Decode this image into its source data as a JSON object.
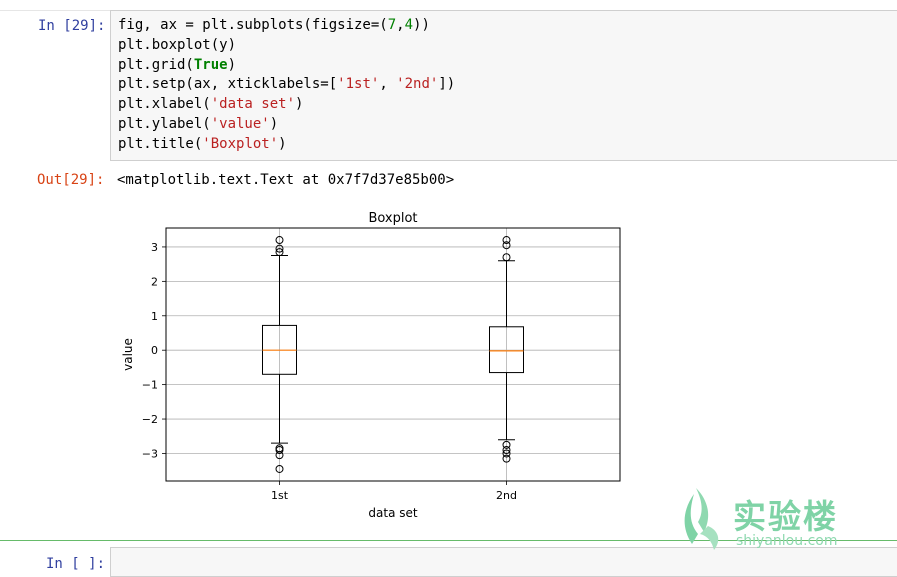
{
  "cells": {
    "code_prompt": "In [29]:",
    "code_lines": [
      [
        {
          "t": "fig, ax = plt.subplots(figsize=(",
          "c": ""
        },
        {
          "t": "7",
          "c": "num"
        },
        {
          "t": ",",
          "c": ""
        },
        {
          "t": "4",
          "c": "num"
        },
        {
          "t": "))",
          "c": ""
        }
      ],
      [
        {
          "t": "plt.boxplot(y)",
          "c": ""
        }
      ],
      [
        {
          "t": "plt.grid(",
          "c": ""
        },
        {
          "t": "True",
          "c": "kw"
        },
        {
          "t": ")",
          "c": ""
        }
      ],
      [
        {
          "t": "plt.setp(ax, xticklabels=[",
          "c": ""
        },
        {
          "t": "'1st'",
          "c": "str"
        },
        {
          "t": ", ",
          "c": ""
        },
        {
          "t": "'2nd'",
          "c": "str"
        },
        {
          "t": "])",
          "c": ""
        }
      ],
      [
        {
          "t": "plt.xlabel(",
          "c": ""
        },
        {
          "t": "'data set'",
          "c": "str"
        },
        {
          "t": ")",
          "c": ""
        }
      ],
      [
        {
          "t": "plt.ylabel(",
          "c": ""
        },
        {
          "t": "'value'",
          "c": "str"
        },
        {
          "t": ")",
          "c": ""
        }
      ],
      [
        {
          "t": "plt.title(",
          "c": ""
        },
        {
          "t": "'Boxplot'",
          "c": "str"
        },
        {
          "t": ")",
          "c": ""
        }
      ]
    ],
    "out_prompt": "Out[29]:",
    "out_text": "<matplotlib.text.Text at 0x7f7d37e85b00>",
    "empty_prompt": "In [ ]:"
  },
  "logo": {
    "text": "实验楼",
    "subtext": "shiyanlou.com",
    "color": "#7fd3a6"
  },
  "chart_data": {
    "type": "box",
    "title": "Boxplot",
    "xlabel": "data set",
    "ylabel": "value",
    "categories": [
      "1st",
      "2nd"
    ],
    "yticks": [
      -3,
      -2,
      -1,
      0,
      1,
      2,
      3
    ],
    "ylim": [
      -3.8,
      3.55
    ],
    "grid": true,
    "boxes": [
      {
        "name": "1st",
        "q1": -0.7,
        "median": 0.0,
        "q3": 0.72,
        "whisker_low": -2.7,
        "whisker_high": 2.75,
        "outliers": [
          3.2,
          2.95,
          2.85,
          -2.85,
          -2.9,
          -3.05,
          -3.45
        ]
      },
      {
        "name": "2nd",
        "q1": -0.65,
        "median": -0.02,
        "q3": 0.68,
        "whisker_low": -2.6,
        "whisker_high": 2.6,
        "outliers": [
          3.2,
          3.05,
          2.7,
          -2.75,
          -2.9,
          -3.0,
          -3.15
        ]
      }
    ],
    "colors": {
      "box": "#000000",
      "median": "#ff7f0e",
      "grid": "#b0b0b0"
    }
  }
}
